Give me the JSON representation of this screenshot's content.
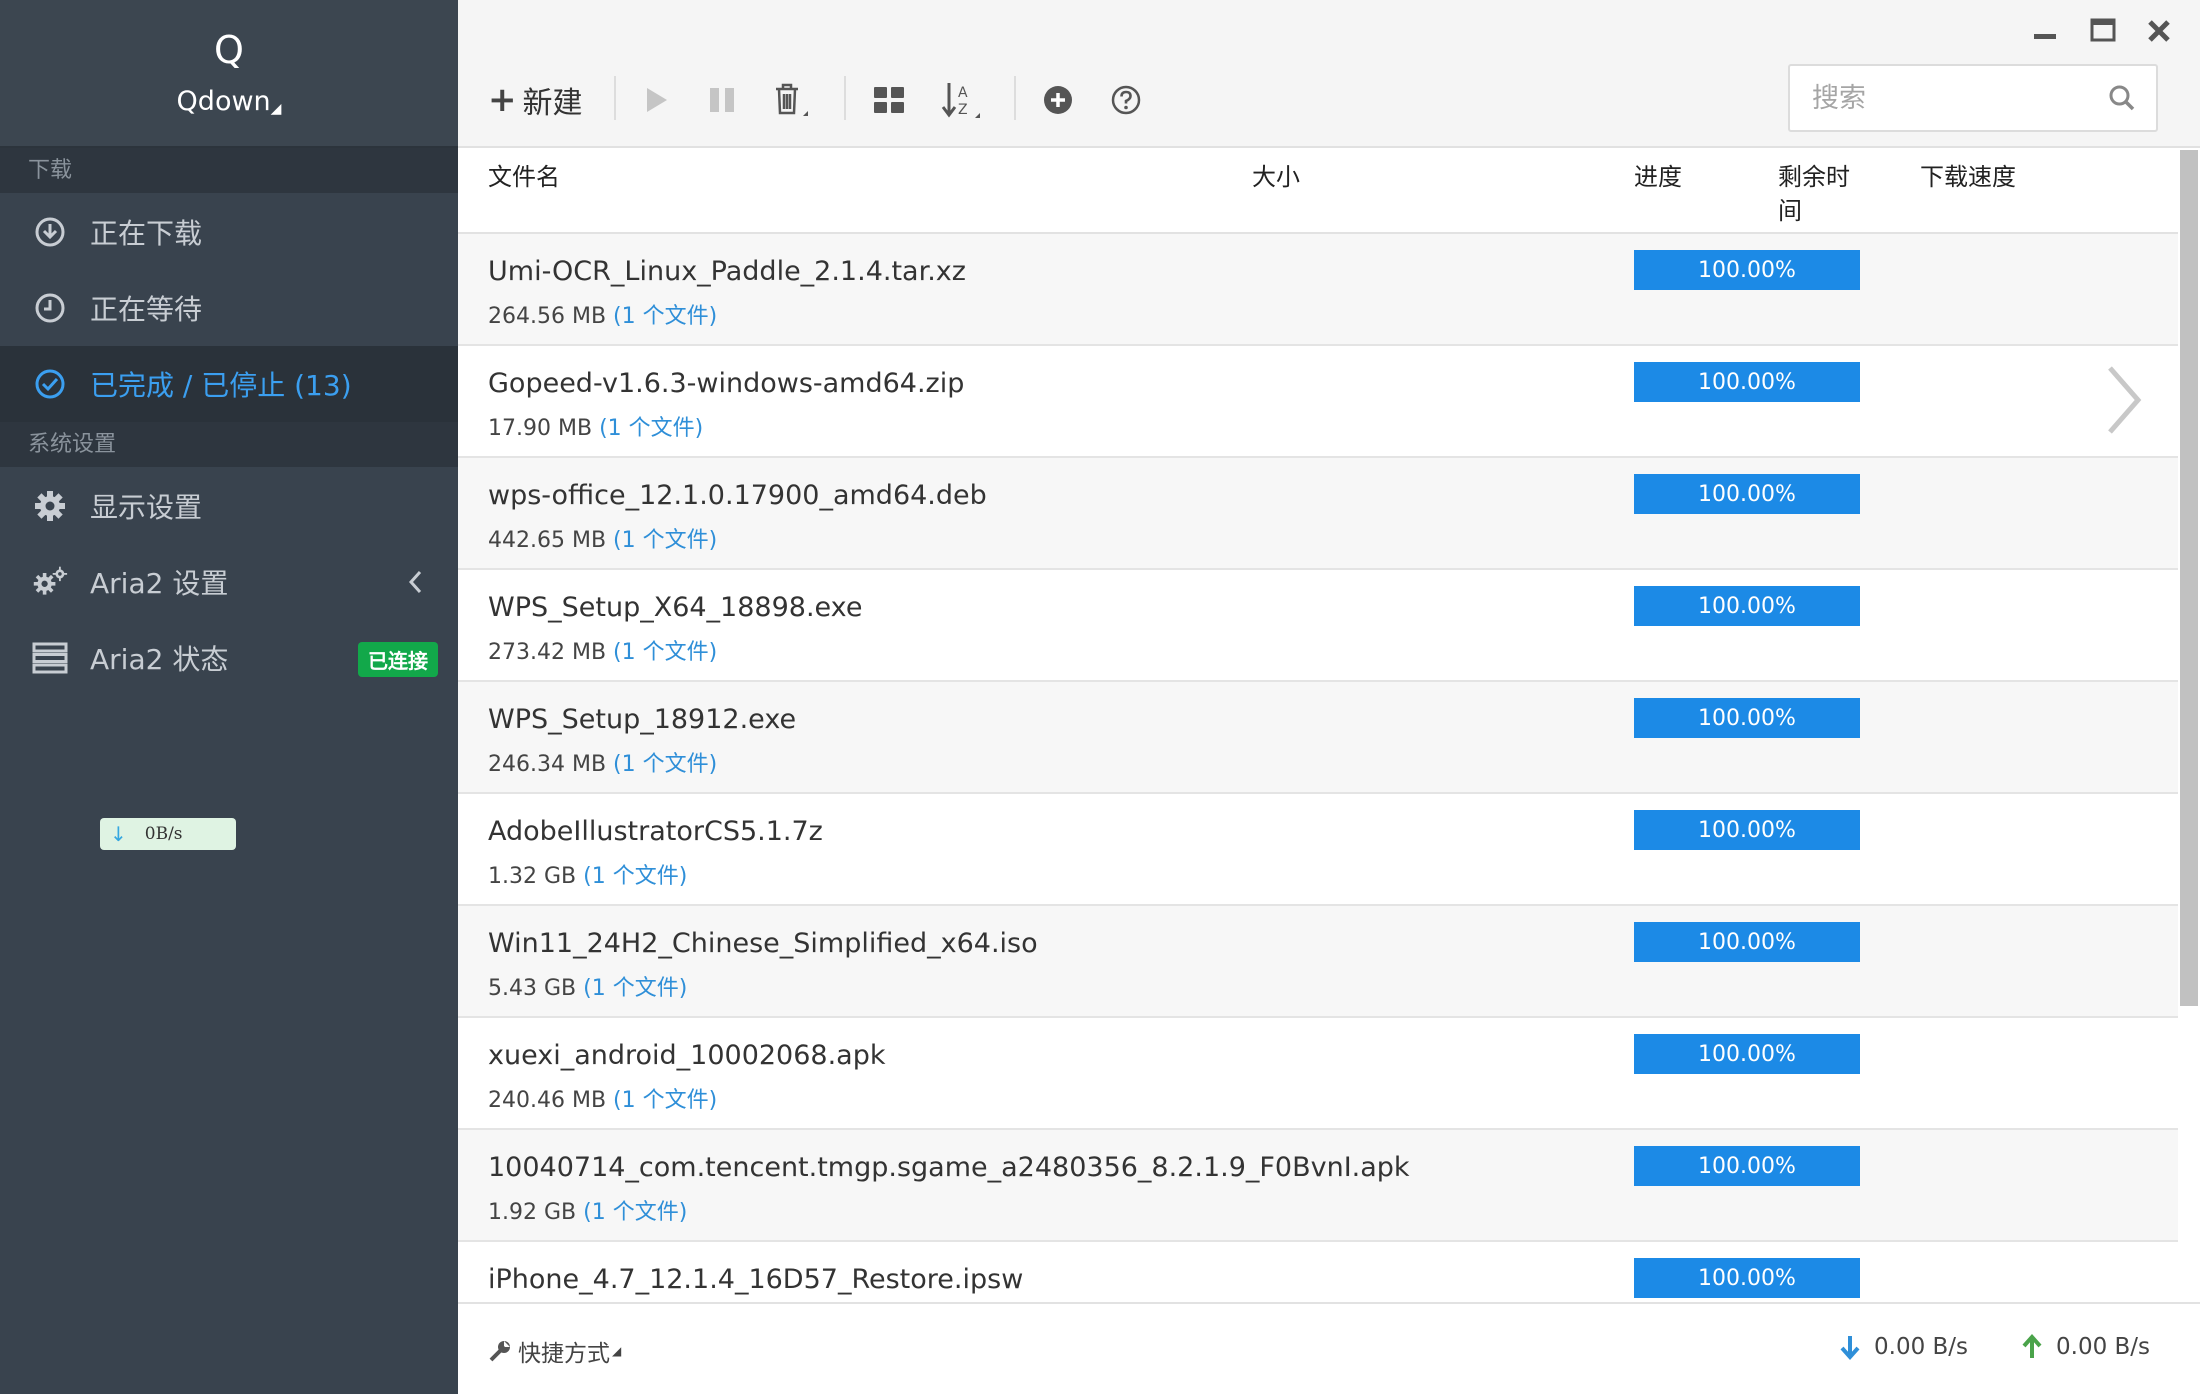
{
  "brand": {
    "logo_letter": "Q",
    "name": "Qdown"
  },
  "sidebar": {
    "section_download": "下载",
    "items": [
      {
        "label": "正在下载",
        "icon": "download-circle-icon"
      },
      {
        "label": "正在等待",
        "icon": "clock-icon"
      },
      {
        "label": "已完成 / 已停止 (13)",
        "icon": "check-circle-icon",
        "active": true
      }
    ],
    "section_settings": "系统设置",
    "settings_items": [
      {
        "label": "显示设置",
        "icon": "gear-icon"
      },
      {
        "label": "Aria2 设置",
        "icon": "gears-icon"
      },
      {
        "label": "Aria2 状态",
        "icon": "server-icon",
        "badge": "已连接"
      }
    ],
    "speed_pill": "0B/s"
  },
  "toolbar": {
    "new_label": "新建"
  },
  "search": {
    "placeholder": "搜索"
  },
  "table": {
    "headers": {
      "name": "文件名",
      "size": "大小",
      "progress": "进度",
      "remaining": "剩余时间",
      "speed": "下载速度"
    },
    "rows": [
      {
        "name": "Umi-OCR_Linux_Paddle_2.1.4.tar.xz",
        "size": "264.56 MB",
        "count": "(1 个文件)",
        "progress": "100.00%"
      },
      {
        "name": "Gopeed-v1.6.3-windows-amd64.zip",
        "size": "17.90 MB",
        "count": "(1 个文件)",
        "progress": "100.00%"
      },
      {
        "name": "wps-office_12.1.0.17900_amd64.deb",
        "size": "442.65 MB",
        "count": "(1 个文件)",
        "progress": "100.00%"
      },
      {
        "name": "WPS_Setup_X64_18898.exe",
        "size": "273.42 MB",
        "count": "(1 个文件)",
        "progress": "100.00%"
      },
      {
        "name": "WPS_Setup_18912.exe",
        "size": "246.34 MB",
        "count": "(1 个文件)",
        "progress": "100.00%"
      },
      {
        "name": "AdobeIllustratorCS5.1.7z",
        "size": "1.32 GB",
        "count": "(1 个文件)",
        "progress": "100.00%"
      },
      {
        "name": "Win11_24H2_Chinese_Simplified_x64.iso",
        "size": "5.43 GB",
        "count": "(1 个文件)",
        "progress": "100.00%"
      },
      {
        "name": "xuexi_android_10002068.apk",
        "size": "240.46 MB",
        "count": "(1 个文件)",
        "progress": "100.00%"
      },
      {
        "name": "10040714_com.tencent.tmgp.sgame_a2480356_8.2.1.9_F0BvnI.apk",
        "size": "1.92 GB",
        "count": "(1 个文件)",
        "progress": "100.00%"
      },
      {
        "name": "iPhone_4.7_12.1.4_16D57_Restore.ipsw",
        "size": "",
        "count": "",
        "progress": "100.00%"
      }
    ]
  },
  "footer": {
    "shortcuts": "快捷方式",
    "download_speed": "0.00 B/s",
    "upload_speed": "0.00 B/s"
  },
  "colors": {
    "accent": "#1c8ae6",
    "sidebar_bg": "#39434e",
    "badge_green": "#12a84a"
  }
}
